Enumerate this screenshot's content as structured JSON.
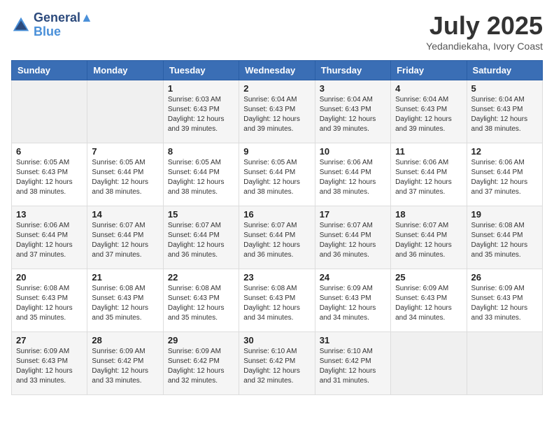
{
  "header": {
    "logo_line1": "General",
    "logo_line2": "Blue",
    "month": "July 2025",
    "location": "Yedandiekaha, Ivory Coast"
  },
  "weekdays": [
    "Sunday",
    "Monday",
    "Tuesday",
    "Wednesday",
    "Thursday",
    "Friday",
    "Saturday"
  ],
  "weeks": [
    [
      {
        "day": "",
        "sunrise": "",
        "sunset": "",
        "daylight": ""
      },
      {
        "day": "",
        "sunrise": "",
        "sunset": "",
        "daylight": ""
      },
      {
        "day": "1",
        "sunrise": "Sunrise: 6:03 AM",
        "sunset": "Sunset: 6:43 PM",
        "daylight": "Daylight: 12 hours and 39 minutes."
      },
      {
        "day": "2",
        "sunrise": "Sunrise: 6:04 AM",
        "sunset": "Sunset: 6:43 PM",
        "daylight": "Daylight: 12 hours and 39 minutes."
      },
      {
        "day": "3",
        "sunrise": "Sunrise: 6:04 AM",
        "sunset": "Sunset: 6:43 PM",
        "daylight": "Daylight: 12 hours and 39 minutes."
      },
      {
        "day": "4",
        "sunrise": "Sunrise: 6:04 AM",
        "sunset": "Sunset: 6:43 PM",
        "daylight": "Daylight: 12 hours and 39 minutes."
      },
      {
        "day": "5",
        "sunrise": "Sunrise: 6:04 AM",
        "sunset": "Sunset: 6:43 PM",
        "daylight": "Daylight: 12 hours and 38 minutes."
      }
    ],
    [
      {
        "day": "6",
        "sunrise": "Sunrise: 6:05 AM",
        "sunset": "Sunset: 6:43 PM",
        "daylight": "Daylight: 12 hours and 38 minutes."
      },
      {
        "day": "7",
        "sunrise": "Sunrise: 6:05 AM",
        "sunset": "Sunset: 6:44 PM",
        "daylight": "Daylight: 12 hours and 38 minutes."
      },
      {
        "day": "8",
        "sunrise": "Sunrise: 6:05 AM",
        "sunset": "Sunset: 6:44 PM",
        "daylight": "Daylight: 12 hours and 38 minutes."
      },
      {
        "day": "9",
        "sunrise": "Sunrise: 6:05 AM",
        "sunset": "Sunset: 6:44 PM",
        "daylight": "Daylight: 12 hours and 38 minutes."
      },
      {
        "day": "10",
        "sunrise": "Sunrise: 6:06 AM",
        "sunset": "Sunset: 6:44 PM",
        "daylight": "Daylight: 12 hours and 38 minutes."
      },
      {
        "day": "11",
        "sunrise": "Sunrise: 6:06 AM",
        "sunset": "Sunset: 6:44 PM",
        "daylight": "Daylight: 12 hours and 37 minutes."
      },
      {
        "day": "12",
        "sunrise": "Sunrise: 6:06 AM",
        "sunset": "Sunset: 6:44 PM",
        "daylight": "Daylight: 12 hours and 37 minutes."
      }
    ],
    [
      {
        "day": "13",
        "sunrise": "Sunrise: 6:06 AM",
        "sunset": "Sunset: 6:44 PM",
        "daylight": "Daylight: 12 hours and 37 minutes."
      },
      {
        "day": "14",
        "sunrise": "Sunrise: 6:07 AM",
        "sunset": "Sunset: 6:44 PM",
        "daylight": "Daylight: 12 hours and 37 minutes."
      },
      {
        "day": "15",
        "sunrise": "Sunrise: 6:07 AM",
        "sunset": "Sunset: 6:44 PM",
        "daylight": "Daylight: 12 hours and 36 minutes."
      },
      {
        "day": "16",
        "sunrise": "Sunrise: 6:07 AM",
        "sunset": "Sunset: 6:44 PM",
        "daylight": "Daylight: 12 hours and 36 minutes."
      },
      {
        "day": "17",
        "sunrise": "Sunrise: 6:07 AM",
        "sunset": "Sunset: 6:44 PM",
        "daylight": "Daylight: 12 hours and 36 minutes."
      },
      {
        "day": "18",
        "sunrise": "Sunrise: 6:07 AM",
        "sunset": "Sunset: 6:44 PM",
        "daylight": "Daylight: 12 hours and 36 minutes."
      },
      {
        "day": "19",
        "sunrise": "Sunrise: 6:08 AM",
        "sunset": "Sunset: 6:44 PM",
        "daylight": "Daylight: 12 hours and 35 minutes."
      }
    ],
    [
      {
        "day": "20",
        "sunrise": "Sunrise: 6:08 AM",
        "sunset": "Sunset: 6:43 PM",
        "daylight": "Daylight: 12 hours and 35 minutes."
      },
      {
        "day": "21",
        "sunrise": "Sunrise: 6:08 AM",
        "sunset": "Sunset: 6:43 PM",
        "daylight": "Daylight: 12 hours and 35 minutes."
      },
      {
        "day": "22",
        "sunrise": "Sunrise: 6:08 AM",
        "sunset": "Sunset: 6:43 PM",
        "daylight": "Daylight: 12 hours and 35 minutes."
      },
      {
        "day": "23",
        "sunrise": "Sunrise: 6:08 AM",
        "sunset": "Sunset: 6:43 PM",
        "daylight": "Daylight: 12 hours and 34 minutes."
      },
      {
        "day": "24",
        "sunrise": "Sunrise: 6:09 AM",
        "sunset": "Sunset: 6:43 PM",
        "daylight": "Daylight: 12 hours and 34 minutes."
      },
      {
        "day": "25",
        "sunrise": "Sunrise: 6:09 AM",
        "sunset": "Sunset: 6:43 PM",
        "daylight": "Daylight: 12 hours and 34 minutes."
      },
      {
        "day": "26",
        "sunrise": "Sunrise: 6:09 AM",
        "sunset": "Sunset: 6:43 PM",
        "daylight": "Daylight: 12 hours and 33 minutes."
      }
    ],
    [
      {
        "day": "27",
        "sunrise": "Sunrise: 6:09 AM",
        "sunset": "Sunset: 6:43 PM",
        "daylight": "Daylight: 12 hours and 33 minutes."
      },
      {
        "day": "28",
        "sunrise": "Sunrise: 6:09 AM",
        "sunset": "Sunset: 6:42 PM",
        "daylight": "Daylight: 12 hours and 33 minutes."
      },
      {
        "day": "29",
        "sunrise": "Sunrise: 6:09 AM",
        "sunset": "Sunset: 6:42 PM",
        "daylight": "Daylight: 12 hours and 32 minutes."
      },
      {
        "day": "30",
        "sunrise": "Sunrise: 6:10 AM",
        "sunset": "Sunset: 6:42 PM",
        "daylight": "Daylight: 12 hours and 32 minutes."
      },
      {
        "day": "31",
        "sunrise": "Sunrise: 6:10 AM",
        "sunset": "Sunset: 6:42 PM",
        "daylight": "Daylight: 12 hours and 31 minutes."
      },
      {
        "day": "",
        "sunrise": "",
        "sunset": "",
        "daylight": ""
      },
      {
        "day": "",
        "sunrise": "",
        "sunset": "",
        "daylight": ""
      }
    ]
  ]
}
